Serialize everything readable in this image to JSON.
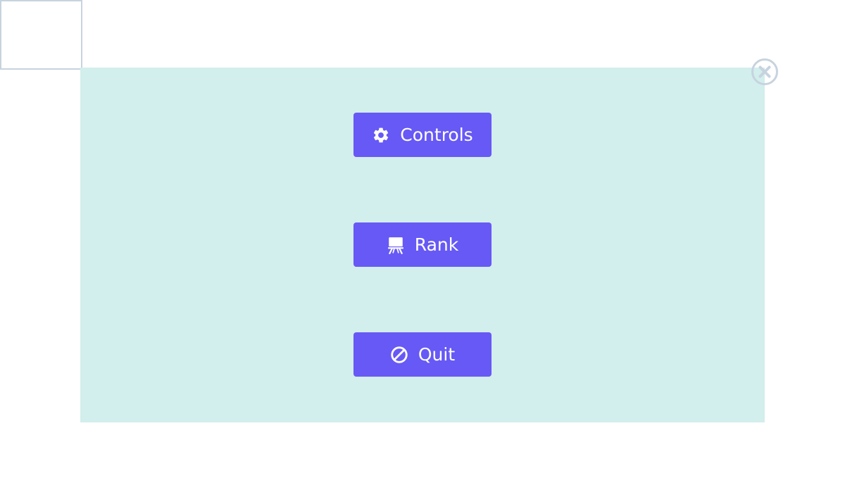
{
  "colors": {
    "panel_background": "#d2eeed",
    "button_background": "#6759f5",
    "button_text": "#ffffff",
    "close_icon": "#c7d3df",
    "corner_border": "#c7d3df"
  },
  "menu": {
    "buttons": [
      {
        "label": "Controls",
        "icon": "gear-icon"
      },
      {
        "label": "Rank",
        "icon": "easel-icon"
      },
      {
        "label": "Quit",
        "icon": "ban-icon"
      }
    ]
  },
  "close": {
    "icon": "close-circle-icon"
  }
}
